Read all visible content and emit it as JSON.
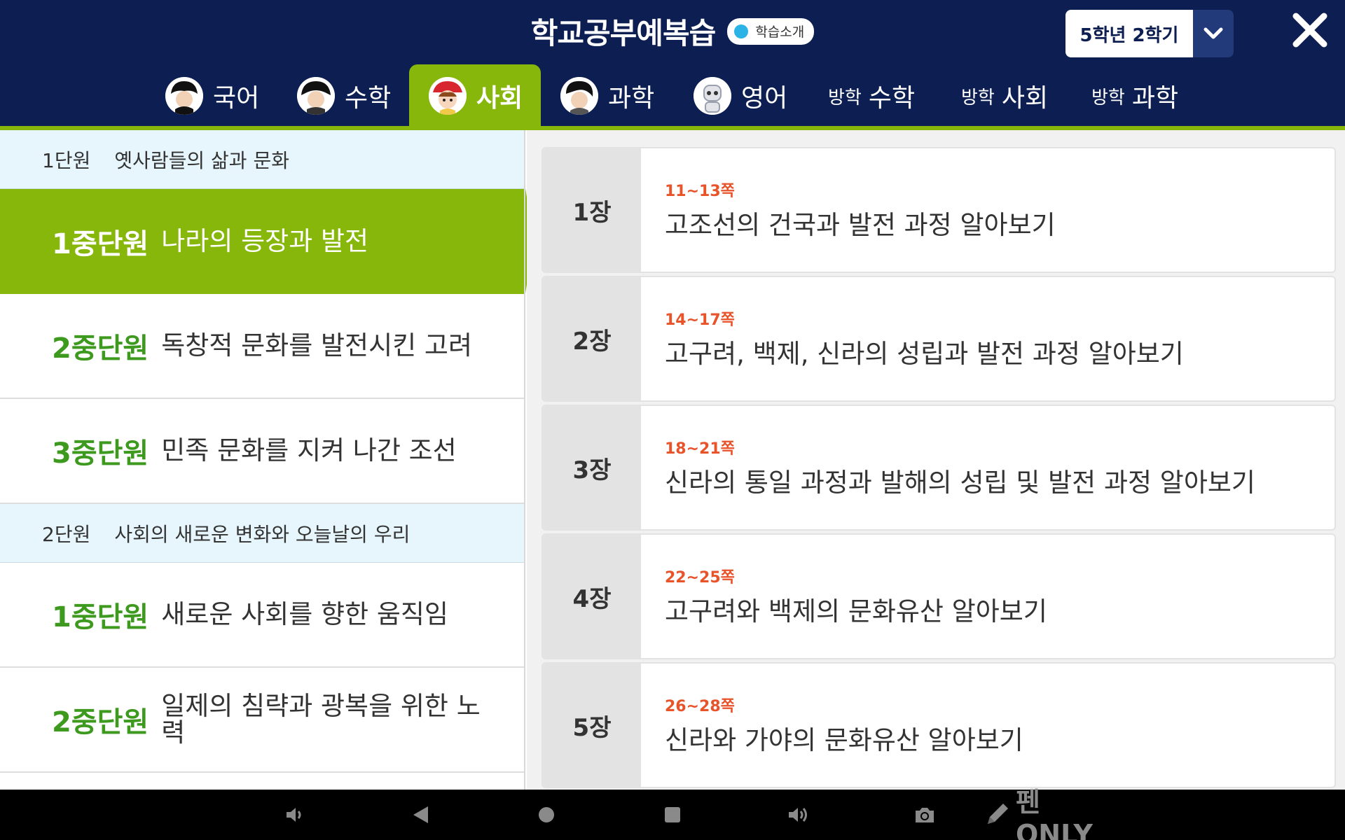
{
  "header": {
    "title": "학교공부예복습",
    "intro_label": "학습소개",
    "grade_label": "5학년 2학기"
  },
  "tabs": [
    {
      "label": "국어",
      "prefix": ""
    },
    {
      "label": "수학",
      "prefix": ""
    },
    {
      "label": "사회",
      "prefix": ""
    },
    {
      "label": "과학",
      "prefix": ""
    },
    {
      "label": "영어",
      "prefix": ""
    },
    {
      "label": "수학",
      "prefix": "방학"
    },
    {
      "label": "사회",
      "prefix": "방학"
    },
    {
      "label": "과학",
      "prefix": "방학"
    }
  ],
  "active_tab": "사회",
  "units": [
    {
      "num": "1단원",
      "name": "옛사람들의 삶과 문화",
      "subunits": [
        {
          "num": "1중단원",
          "name": "나라의 등장과 발전"
        },
        {
          "num": "2중단원",
          "name": "독창적 문화를 발전시킨 고려"
        },
        {
          "num": "3중단원",
          "name": "민족 문화를 지켜 나간 조선"
        }
      ]
    },
    {
      "num": "2단원",
      "name": "사회의 새로운 변화와 오늘날의 우리",
      "subunits": [
        {
          "num": "1중단원",
          "name": "새로운 사회를 향한 움직임"
        },
        {
          "num": "2중단원",
          "name": "일제의 침략과 광복을 위한 노력"
        }
      ]
    }
  ],
  "chapters": [
    {
      "num": "1장",
      "pages": "11~13쪽",
      "title": "고조선의 건국과 발전 과정 알아보기"
    },
    {
      "num": "2장",
      "pages": "14~17쪽",
      "title": "고구려, 백제, 신라의 성립과 발전 과정 알아보기"
    },
    {
      "num": "3장",
      "pages": "18~21쪽",
      "title": "신라의 통일 과정과 발해의 성립 및 발전 과정 알아보기"
    },
    {
      "num": "4장",
      "pages": "22~25쪽",
      "title": "고구려와 백제의 문화유산 알아보기"
    },
    {
      "num": "5장",
      "pages": "26~28쪽",
      "title": "신라와 가야의 문화유산 알아보기"
    }
  ],
  "navbar": {
    "pen_label": "펜 ONLY",
    "icons": [
      "volume-down-icon",
      "back-icon",
      "home-icon",
      "recents-icon",
      "volume-up-icon",
      "camera-icon",
      "pen-icon"
    ]
  },
  "colors": {
    "header_bg": "#0d1f52",
    "accent_green": "#87b70a",
    "subunit_green": "#3d9a1e",
    "page_orange": "#e8532a",
    "unit_header_bg": "#e6f6fc"
  }
}
